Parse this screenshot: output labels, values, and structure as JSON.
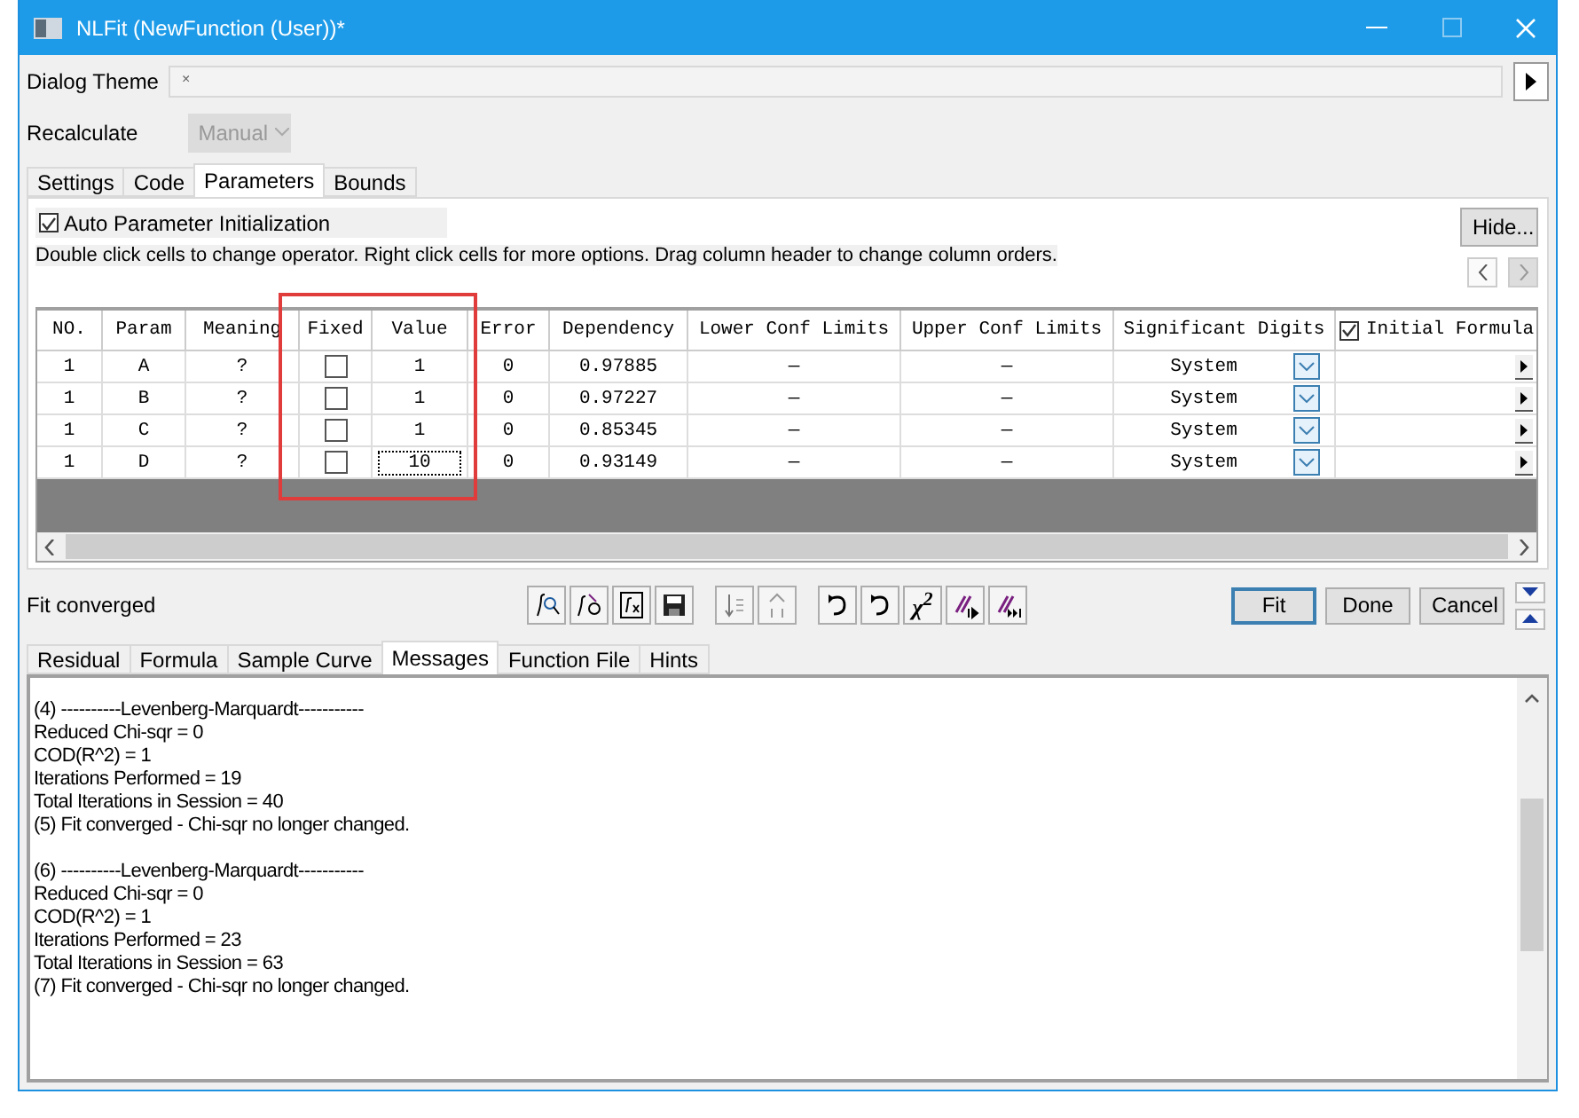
{
  "window": {
    "title": "NLFit (NewFunction (User))*"
  },
  "dialog_theme": {
    "label": "Dialog Theme",
    "value": "×"
  },
  "recalculate": {
    "label": "Recalculate",
    "value": "Manual",
    "disabled": true
  },
  "tabs": [
    {
      "label": "Settings",
      "selected": false
    },
    {
      "label": "Code",
      "selected": false
    },
    {
      "label": "Parameters",
      "selected": true
    },
    {
      "label": "Bounds",
      "selected": false
    }
  ],
  "auto_init": {
    "label": "Auto Parameter Initialization",
    "checked": true
  },
  "hint": "Double click cells to change operator. Right click cells for more options. Drag column header to change column orders.",
  "hide_button": "Hide...",
  "table": {
    "columns": [
      "NO.",
      "Param",
      "Meaning",
      "Fixed",
      "Value",
      "Error",
      "Dependency",
      "Lower Conf Limits",
      "Upper Conf Limits",
      "Significant Digits",
      "Initial Formula"
    ],
    "initial_formula_checked": true,
    "rows": [
      {
        "no": "1",
        "param": "A",
        "meaning": "?",
        "fixed": false,
        "value": "1",
        "focused": false,
        "error": "0",
        "dependency": "0.97885",
        "lower": "—",
        "upper": "—",
        "digits": "System"
      },
      {
        "no": "1",
        "param": "B",
        "meaning": "?",
        "fixed": false,
        "value": "1",
        "focused": false,
        "error": "0",
        "dependency": "0.97227",
        "lower": "—",
        "upper": "—",
        "digits": "System"
      },
      {
        "no": "1",
        "param": "C",
        "meaning": "?",
        "fixed": false,
        "value": "1",
        "focused": false,
        "error": "0",
        "dependency": "0.85345",
        "lower": "—",
        "upper": "—",
        "digits": "System"
      },
      {
        "no": "1",
        "param": "D",
        "meaning": "?",
        "fixed": false,
        "value": "10",
        "focused": true,
        "error": "0",
        "dependency": "0.93149",
        "lower": "—",
        "upper": "—",
        "digits": "System"
      }
    ]
  },
  "status": "Fit converged",
  "chi_label": "χ$^{2}$",
  "actions": [
    {
      "label": "Fit",
      "focused": true
    },
    {
      "label": "Done",
      "focused": false
    },
    {
      "label": "Cancel",
      "focused": false
    }
  ],
  "lower_tabs": [
    {
      "label": "Residual",
      "selected": false
    },
    {
      "label": "Formula",
      "selected": false
    },
    {
      "label": "Sample Curve",
      "selected": false
    },
    {
      "label": "Messages",
      "selected": true
    },
    {
      "label": "Function File",
      "selected": false
    },
    {
      "label": "Hints",
      "selected": false
    }
  ],
  "messages": [
    [
      "(4) ----------Levenberg-Marquardt-----------",
      "Reduced Chi-sqr = 0",
      "COD(R^2) = 1",
      "Iterations Performed = 19",
      "Total Iterations in Session = 40",
      "(5) Fit converged - Chi-sqr no longer changed."
    ],
    [
      "(6) ----------Levenberg-Marquardt-----------",
      "Reduced Chi-sqr = 0",
      "COD(R^2) = 1",
      "Iterations Performed = 23",
      "Total Iterations in Session = 63",
      "(7) Fit converged - Chi-sqr no longer changed."
    ]
  ]
}
